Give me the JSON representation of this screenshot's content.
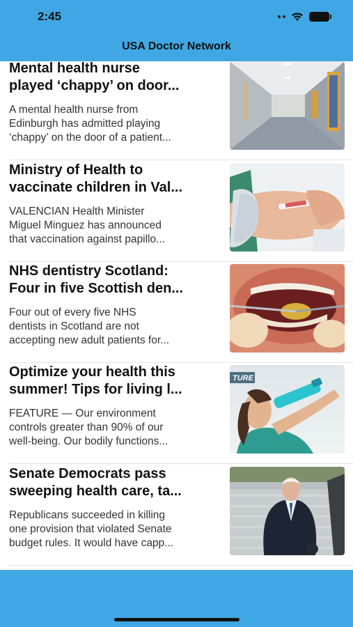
{
  "status_bar": {
    "time": "2:45"
  },
  "nav": {
    "title": "USA Doctor Network"
  },
  "articles": [
    {
      "title_line1": "Mental health nurse",
      "title_line2": "played ‘chappy’ on door...",
      "summary_line1": "A mental health nurse from",
      "summary_line2": "Edinburgh has admitted playing",
      "summary_line3": "‘chappy’ on the door of a patient...",
      "image": "hospital-corridor"
    },
    {
      "title_line1": "Ministry of Health to",
      "title_line2": "vaccinate children in Val...",
      "summary_line1": "VALENCIAN Health Minister",
      "summary_line2": "Miguel Minguez has announced",
      "summary_line3": "that vaccination against papillo...",
      "image": "vaccination-arm"
    },
    {
      "title_line1": "NHS dentistry Scotland:",
      "title_line2": "Four in five Scottish den...",
      "summary_line1": "Four out of every five NHS",
      "summary_line2": "dentists in Scotland are not",
      "summary_line3": "accepting new adult patients for...",
      "image": "dental-exam"
    },
    {
      "title_line1": "Optimize your health this",
      "title_line2": "summer! Tips for living l...",
      "summary_line1": "FEATURE — Our environment",
      "summary_line2": "controls greater than 90% of our",
      "summary_line3": "well-being. Our bodily functions...",
      "image": "woman-drinking-water",
      "image_tag": "TURE"
    },
    {
      "title_line1": "Senate Democrats pass",
      "title_line2": "sweeping health care, ta...",
      "summary_line1": "Republicans succeeded in killing",
      "summary_line2": "one provision that violated Senate",
      "summary_line3": "budget rules. It would have capp...",
      "image": "man-in-suit"
    }
  ],
  "colors": {
    "brand": "#3fa8e4"
  }
}
